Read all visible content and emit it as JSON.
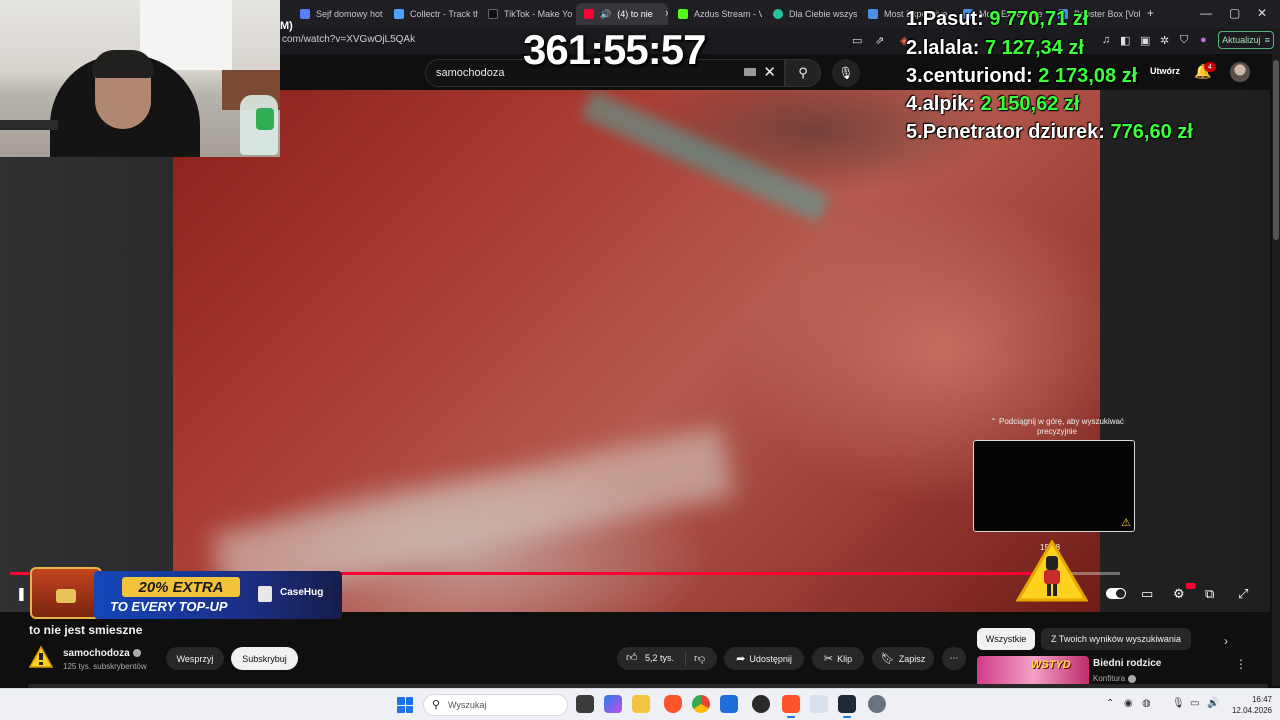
{
  "browser": {
    "tabs": [
      {
        "label": "Sejf domowy hot",
        "icon": "tab-favicon",
        "color": "#5b7cfa"
      },
      {
        "label": "Collectr - Track th",
        "icon": "tab-favicon",
        "color": "#4aa3ff"
      },
      {
        "label": "TikTok - Make Yo",
        "icon": "tiktok-icon",
        "color": "#111111"
      },
      {
        "label": "(4) to nie",
        "icon": "youtube-icon",
        "color": "#ff0033",
        "active": true
      },
      {
        "label": "Azdus Stream - V",
        "icon": "kick-icon",
        "color": "#53fc18"
      },
      {
        "label": "Dla Ciebie wszys",
        "icon": "tab-favicon",
        "color": "#25c2a0"
      },
      {
        "label": "Most Expensive",
        "icon": "tab-favicon",
        "color": "#4a90e2"
      },
      {
        "label": "Most Expensive",
        "icon": "tab-favicon",
        "color": "#4a90e2"
      },
      {
        "label": "Booster Box [Vol",
        "icon": "tab-favicon",
        "color": "#4a90e2"
      }
    ],
    "url": "com/watch?v=XVGwOjL5QAk",
    "url_prefix": "M)",
    "update_label": "Aktualizuj",
    "window_controls": {
      "minimize": "—",
      "maximize": "▢",
      "close": "✕"
    }
  },
  "youtube": {
    "search_value": "samochodoza",
    "create_label": "Utwórz",
    "notification_count": "4",
    "video": {
      "title": "to nie jest smieszne",
      "swipe_hint": "Podciągnij w górę, aby wyszukiwać precyzyjnie",
      "hover_time": "15:38",
      "progress_fraction": 0.95
    },
    "channel": {
      "name": "samochodoza",
      "subscribers": "125 tys. subskrybentów",
      "support_label": "Wesprzyj",
      "subscribe_label": "Subskrybuj"
    },
    "actions": {
      "likes": "5,2 tys.",
      "share": "Udostępnij",
      "clip": "Klip",
      "save": "Zapisz",
      "more": "⋯"
    },
    "chips": {
      "all": "Wszystkie",
      "from_search": "Z Twoich wyników wyszukiwania"
    },
    "recommendation": {
      "title": "Biedni rodzice",
      "channel": "Konfitura",
      "thumb_text": "WSTYD"
    }
  },
  "overlay": {
    "timer": "361:55:57",
    "leaderboard": [
      {
        "rank": "1.",
        "name": "Pasut:",
        "amount": "9 770,71 zł"
      },
      {
        "rank": "2.",
        "name": "lalala:",
        "amount": "7 127,34 zł"
      },
      {
        "rank": "3.",
        "name": "centuriond:",
        "amount": "2 173,08 zł"
      },
      {
        "rank": "4.",
        "name": "alpik:",
        "amount": "2 150,62 zł"
      },
      {
        "rank": "5.",
        "name": "Penetrator dziurek:",
        "amount": "776,60 zł"
      }
    ],
    "ad": {
      "headline": "20% EXTRA",
      "subline": "TO EVERY TOP-UP",
      "brand": "CaseHug"
    }
  },
  "taskbar": {
    "search_placeholder": "Wyszukaj",
    "time": "16:47",
    "date": "12.04.2026"
  }
}
